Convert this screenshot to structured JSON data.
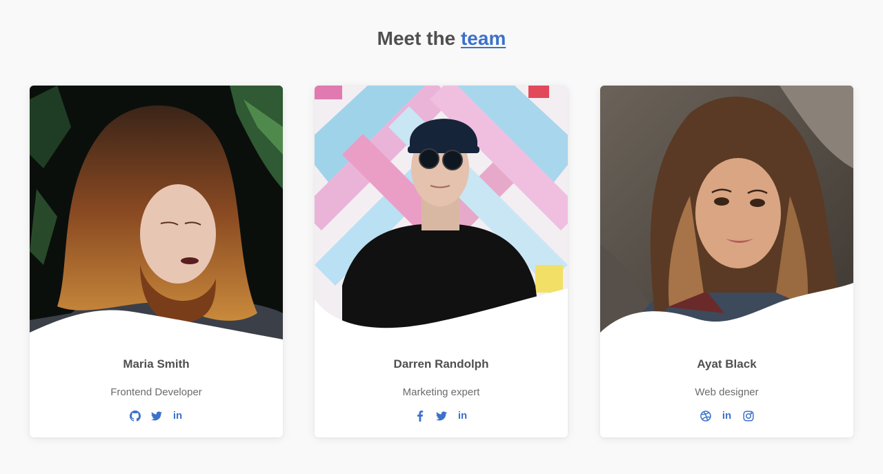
{
  "heading": {
    "prefix": "Meet the",
    "link": "team"
  },
  "colors": {
    "accent": "#3b71ca",
    "text": "#4f4f4f",
    "muted": "#6b6b6b"
  },
  "members": [
    {
      "name": "Maria Smith",
      "role": "Frontend Developer",
      "photo": "woman-with-auburn-hair-portrait",
      "socials": [
        "github-icon",
        "twitter-icon",
        "linkedin-icon"
      ]
    },
    {
      "name": "Darren Randolph",
      "role": "Marketing expert",
      "photo": "man-in-cap-and-sunglasses-portrait",
      "socials": [
        "facebook-icon",
        "twitter-icon",
        "linkedin-icon"
      ]
    },
    {
      "name": "Ayat Black",
      "role": "Web designer",
      "photo": "smiling-woman-with-long-hair-portrait",
      "socials": [
        "dribbble-icon",
        "linkedin-icon",
        "instagram-icon"
      ]
    }
  ],
  "social_text": {
    "linkedin": "in"
  }
}
